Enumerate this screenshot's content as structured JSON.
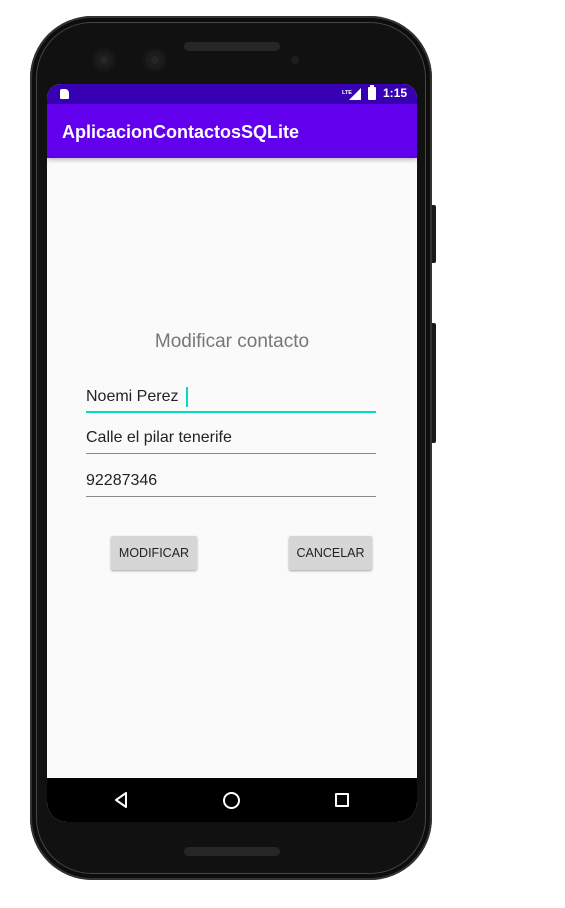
{
  "status_bar": {
    "time": "1:15",
    "network_label": "LTE",
    "background_color": "#3700b3",
    "icons": [
      "sim-card-icon",
      "lte-signal-icon",
      "battery-icon"
    ]
  },
  "app_bar": {
    "title": "AplicacionContactosSQLite",
    "background_color": "#6200ee"
  },
  "form": {
    "title": "Modificar contacto",
    "name_value": "Noemi Perez",
    "address_value": "Calle el pilar tenerife",
    "phone_value": "92287346",
    "accent_color": "#03dac5"
  },
  "buttons": {
    "modify_label": "MODIFICAR",
    "cancel_label": "CANCELAR"
  },
  "nav_bar": {
    "icons": [
      "back-icon",
      "home-icon",
      "recents-icon"
    ]
  }
}
